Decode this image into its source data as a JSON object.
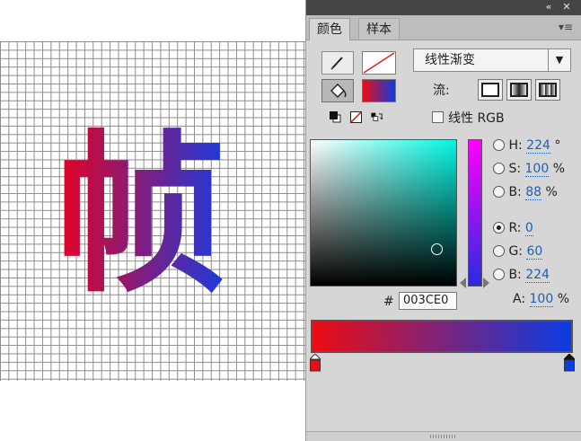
{
  "canvas": {
    "glyph": "帧",
    "glyph_gradient": [
      "#E8001C",
      "#1A3BE0"
    ]
  },
  "panel": {
    "titlebar": {
      "collapse_icon": "«",
      "close_icon": "✕"
    },
    "tabs": [
      {
        "label": "颜色",
        "active": true
      },
      {
        "label": "样本",
        "active": false
      }
    ],
    "menu_icon": "▾≡",
    "fill_type": "线性渐变",
    "flow_label": "流:",
    "linear_rgb_label": "线性 RGB",
    "linear_rgb_checked": false,
    "hsb": {
      "H": "224",
      "S": "100",
      "B": "88"
    },
    "hsb_units": {
      "H": "°",
      "S": "%",
      "B": "%"
    },
    "rgb": {
      "R": "0",
      "G": "60",
      "B": "224"
    },
    "selected_channel": "R",
    "hex_label": "#",
    "hex": "003CE0",
    "alpha_label": "A:",
    "alpha": "100",
    "alpha_unit": "%",
    "gradient": {
      "start_color": "#ED0C12",
      "end_color": "#0B3CE3"
    },
    "colors": {
      "stroke_none": "#e02020",
      "accent": "#1f5fb0"
    }
  }
}
